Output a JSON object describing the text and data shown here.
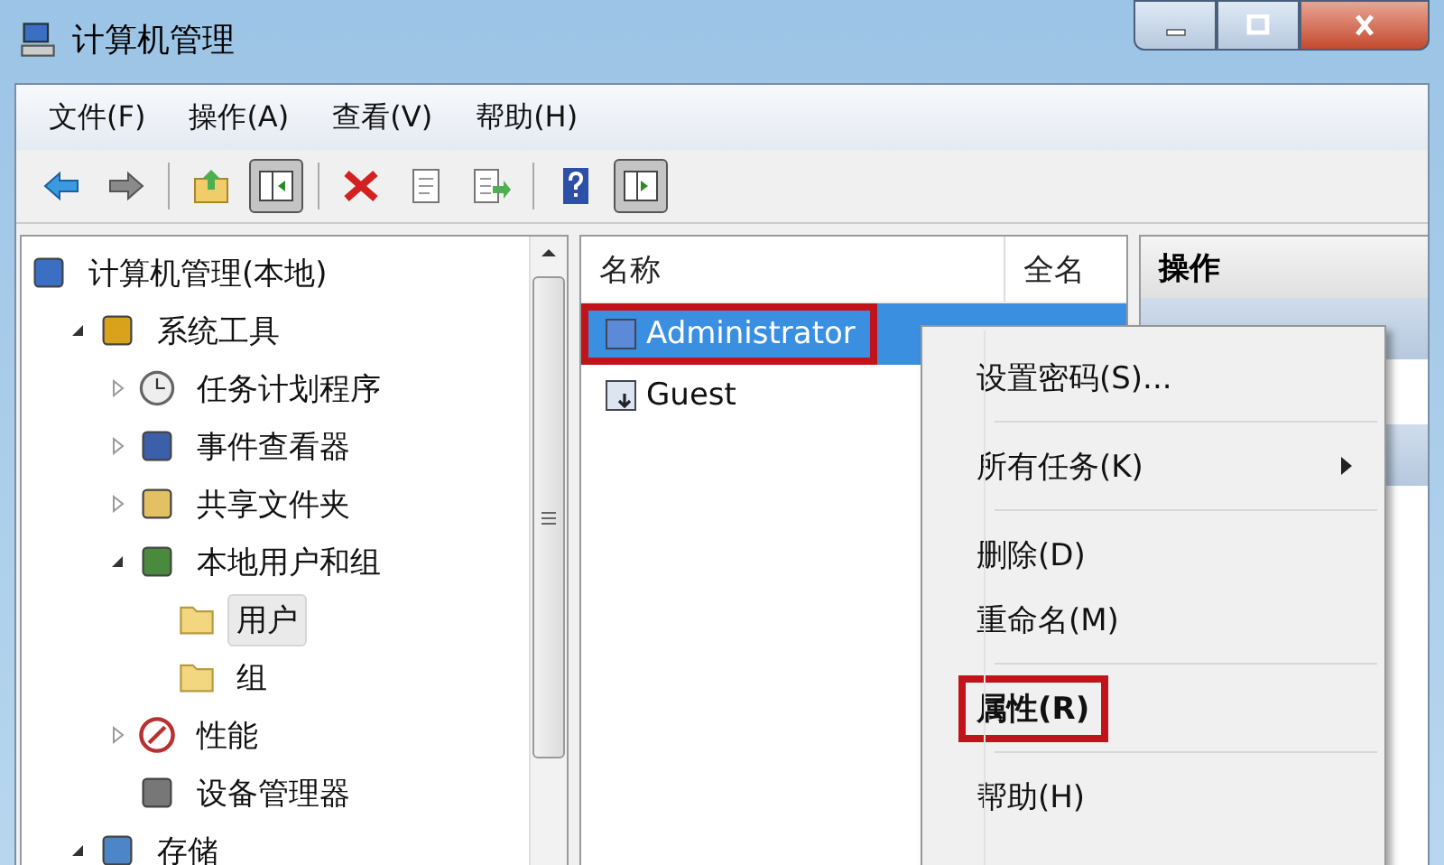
{
  "window": {
    "title": "计算机管理"
  },
  "menu_bar": [
    "文件(F)",
    "操作(A)",
    "查看(V)",
    "帮助(H)"
  ],
  "toolbar": [
    {
      "kind": "back",
      "pressed": false
    },
    {
      "kind": "forward",
      "pressed": false
    },
    {
      "kind": "separator"
    },
    {
      "kind": "up",
      "pressed": false
    },
    {
      "kind": "tree",
      "pressed": true
    },
    {
      "kind": "separator"
    },
    {
      "kind": "delete",
      "pressed": false
    },
    {
      "kind": "properties",
      "pressed": false
    },
    {
      "kind": "export",
      "pressed": false
    },
    {
      "kind": "separator"
    },
    {
      "kind": "help",
      "pressed": false
    },
    {
      "kind": "action",
      "pressed": true
    }
  ],
  "tree": [
    {
      "label": "计算机管理(本地)",
      "kind": "computer",
      "selected": false,
      "children": [
        {
          "label": "系统工具",
          "kind": "tools",
          "expanded": true,
          "selected": false,
          "children": [
            {
              "label": "任务计划程序",
              "kind": "clock",
              "expanded": false,
              "selected": false
            },
            {
              "label": "事件查看器",
              "kind": "log",
              "expanded": false,
              "selected": false
            },
            {
              "label": "共享文件夹",
              "kind": "share",
              "expanded": false,
              "selected": false
            },
            {
              "label": "本地用户和组",
              "kind": "users",
              "expanded": true,
              "selected": false,
              "children": [
                {
                  "label": "用户",
                  "kind": "folder",
                  "selected": true
                },
                {
                  "label": "组",
                  "kind": "folder",
                  "selected": false
                }
              ]
            },
            {
              "label": "性能",
              "kind": "performance",
              "expanded": false,
              "selected": false
            },
            {
              "label": "设备管理器",
              "kind": "device",
              "selected": false
            }
          ]
        },
        {
          "label": "存储",
          "kind": "storage",
          "expanded": true,
          "selected": false
        }
      ]
    }
  ],
  "list": {
    "columns": [
      "名称",
      "全名"
    ],
    "rows": [
      {
        "name": "Administrator",
        "kind": "admin",
        "selected": true,
        "highlighted": true
      },
      {
        "name": "Guest",
        "kind": "guest",
        "selected": false,
        "highlighted": false
      }
    ]
  },
  "actions_pane": {
    "header": "操作"
  },
  "context_menu": [
    {
      "label": "设置密码(S)...",
      "kind": "item",
      "bold": false,
      "submenu": false,
      "highlighted": false
    },
    {
      "kind": "separator"
    },
    {
      "label": "所有任务(K)",
      "kind": "item",
      "bold": false,
      "submenu": true,
      "highlighted": false
    },
    {
      "kind": "separator"
    },
    {
      "label": "删除(D)",
      "kind": "item",
      "bold": false,
      "submenu": false,
      "highlighted": false
    },
    {
      "label": "重命名(M)",
      "kind": "item",
      "bold": false,
      "submenu": false,
      "highlighted": false
    },
    {
      "kind": "separator"
    },
    {
      "label": "属性(R)",
      "kind": "item",
      "bold": true,
      "submenu": false,
      "highlighted": true
    },
    {
      "kind": "separator"
    },
    {
      "label": "帮助(H)",
      "kind": "item",
      "bold": false,
      "submenu": false,
      "highlighted": false
    }
  ]
}
